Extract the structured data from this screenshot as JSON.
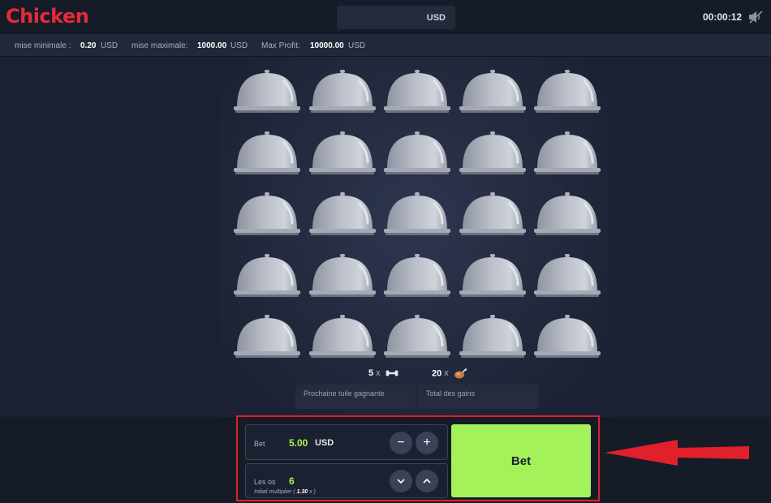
{
  "header": {
    "logo_text": "Chicken",
    "balance_currency": "USD",
    "timer": "00:00:12",
    "sound_icon": "speaker-muted-icon"
  },
  "limits": {
    "min_label": "mise minimale :",
    "min_value": "0.20",
    "min_currency": "USD",
    "max_label": "mise maximale:",
    "max_value": "1000.00",
    "max_currency": "USD",
    "profit_label": "Max Profit:",
    "profit_value": "10000.00",
    "profit_currency": "USD"
  },
  "board": {
    "rows": 5,
    "cols": 5,
    "tile_icon": "cloche-icon"
  },
  "counts": {
    "bones_count": "5",
    "bones_icon": "bone-icon",
    "chicken_count": "20",
    "chicken_icon": "roast-chicken-icon",
    "times": "x"
  },
  "info": {
    "next_tile_label": "Prochaine tuile gagnante",
    "total_label": "Total des gains"
  },
  "bet_panel": {
    "bet_label": "Bet",
    "bet_value": "5.00",
    "bet_currency": "USD",
    "minus_symbol": "−",
    "plus_symbol": "+",
    "bones_label": "Les os",
    "bones_value": "6",
    "multiplier_prefix": "Initial multiplier (",
    "multiplier_value": "1.30",
    "multiplier_suffix": "x )",
    "down_symbol": "⌄",
    "up_symbol": "⌃"
  },
  "bet_button": {
    "label": "Bet"
  },
  "colors": {
    "brand": "#e8293b",
    "accent_green": "#a4f25a",
    "annotation_red": "#e0202a"
  }
}
